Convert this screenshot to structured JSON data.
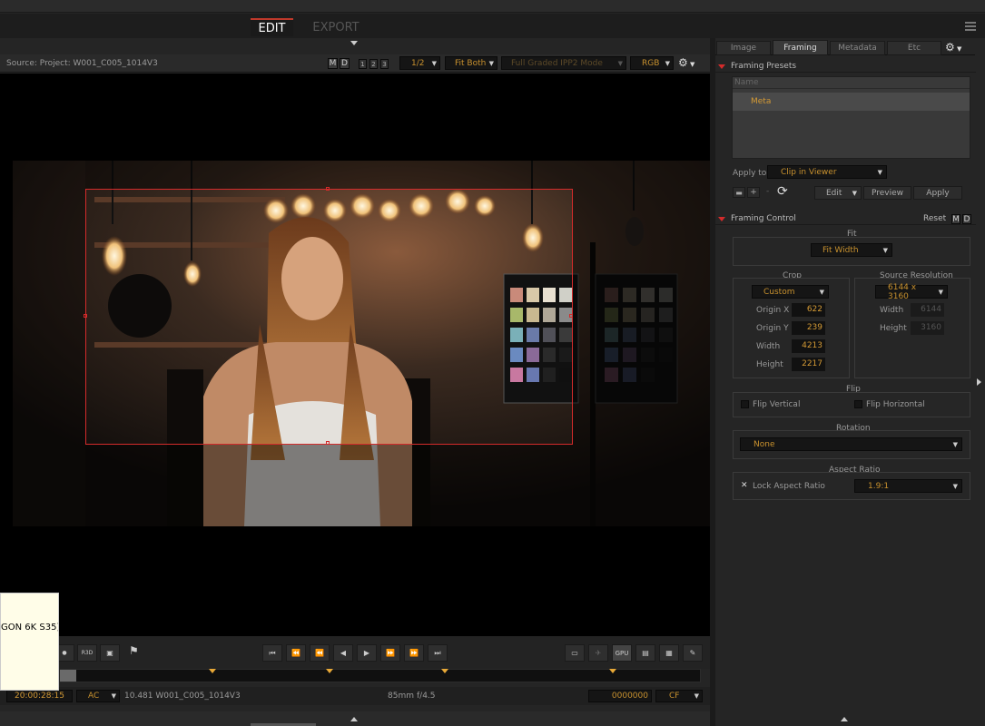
{
  "tabs": {
    "edit": "EDIT",
    "export": "EXPORT"
  },
  "viewer_toolbar": {
    "source": "Source: Project: W001_C005_1014V3",
    "m": "M",
    "d": "D",
    "n1": "1",
    "n2": "2",
    "n3": "3",
    "resolution": "1/2",
    "fit": "Fit Both",
    "mode": "Full Graded IPP2 Mode",
    "channel": "RGB"
  },
  "overlay_label": "GON 6K S35)",
  "timeline": {
    "timecode": "20:00:28:15",
    "ac": "AC",
    "clip_info": "10.481 W001_C005_1014V3",
    "lens": "85mm",
    "aperture": "f/4.5",
    "frame": "0000000",
    "cf": "CF",
    "gpu": "GPU"
  },
  "panel": {
    "tabs": [
      "Image",
      "Framing",
      "Metadata",
      "Etc"
    ],
    "active_tab": "Framing",
    "presets": {
      "title": "Framing Presets",
      "column_header": "Name",
      "items": [
        "Meta"
      ],
      "apply_to_label": "Apply to:",
      "apply_to_value": "Clip in Viewer",
      "plus": "+",
      "minus": "-",
      "edit": "Edit",
      "preview": "Preview",
      "apply": "Apply"
    },
    "control": {
      "title": "Framing Control",
      "reset": "Reset",
      "m": "M",
      "d": "D",
      "fit_label": "Fit",
      "fit_value": "Fit Width",
      "crop_label": "Crop",
      "crop_mode": "Custom",
      "origin_x_label": "Origin X",
      "origin_x": "622",
      "origin_y_label": "Origin Y",
      "origin_y": "239",
      "width_label": "Width",
      "width": "4213",
      "height_label": "Height",
      "height": "2217",
      "source_res_label": "Source Resolution",
      "source_res": "6144 x 3160",
      "src_width_label": "Width",
      "src_width": "6144",
      "src_height_label": "Height",
      "src_height": "3160",
      "flip_label": "Flip",
      "flip_vertical": "Flip Vertical",
      "flip_horizontal": "Flip Horizontal",
      "rotation_label": "Rotation",
      "rotation_value": "None",
      "aspect_label": "Aspect Ratio",
      "lock_aspect": "Lock Aspect Ratio",
      "lock_check": "✕",
      "aspect_value": "1.9:1"
    }
  },
  "colors": {
    "accent": "#d49a35",
    "crop_box": "#d42b2b",
    "tab_underline": "#c0392b"
  }
}
